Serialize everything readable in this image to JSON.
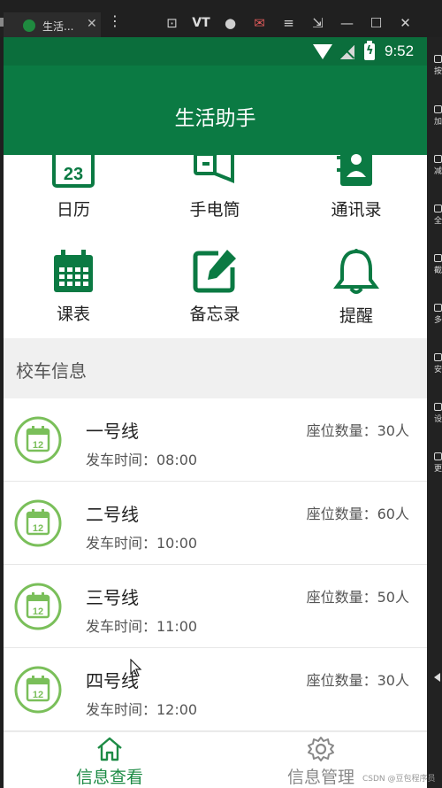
{
  "window": {
    "tab_title": "生活...",
    "tab_close": "✕",
    "more_icon": "⋮",
    "controls": [
      "⊡",
      "VT",
      "●",
      "✉",
      "≡",
      "⇲",
      "—",
      "☐",
      "✕"
    ]
  },
  "side_toolbar": [
    "按",
    "加",
    "减",
    "全",
    "截",
    "多",
    "安",
    "设",
    "更"
  ],
  "status_bar": {
    "time": "9:52"
  },
  "app_bar": {
    "title": "生活助手"
  },
  "functions": [
    {
      "label": "日历",
      "icon": "calendar-icon"
    },
    {
      "label": "手电筒",
      "icon": "flashlight-icon"
    },
    {
      "label": "通讯录",
      "icon": "contacts-icon"
    },
    {
      "label": "课表",
      "icon": "timetable-icon"
    },
    {
      "label": "备忘录",
      "icon": "memo-icon"
    },
    {
      "label": "提醒",
      "icon": "bell-icon"
    }
  ],
  "calendar_day": "23",
  "section": {
    "title": "校车信息"
  },
  "bus_lines": [
    {
      "name": "一号线",
      "departure": "发车时间：08:00",
      "seats": "座位数量：30人",
      "icon_day": "12"
    },
    {
      "name": "二号线",
      "departure": "发车时间：10:00",
      "seats": "座位数量：60人",
      "icon_day": "12"
    },
    {
      "name": "三号线",
      "departure": "发车时间：11:00",
      "seats": "座位数量：50人",
      "icon_day": "12"
    },
    {
      "name": "四号线",
      "departure": "发车时间：12:00",
      "seats": "座位数量：30人",
      "icon_day": "12"
    }
  ],
  "bottom_nav": [
    {
      "label": "信息查看",
      "icon": "home-icon",
      "active": true
    },
    {
      "label": "信息管理",
      "icon": "gear-icon",
      "active": false
    }
  ],
  "watermark": "CSDN @豆包程序员",
  "colors": {
    "primary": "#0b7a43",
    "status": "#0b6e3c",
    "accent": "#1d8b45",
    "icon_green": "#7abf5a"
  }
}
